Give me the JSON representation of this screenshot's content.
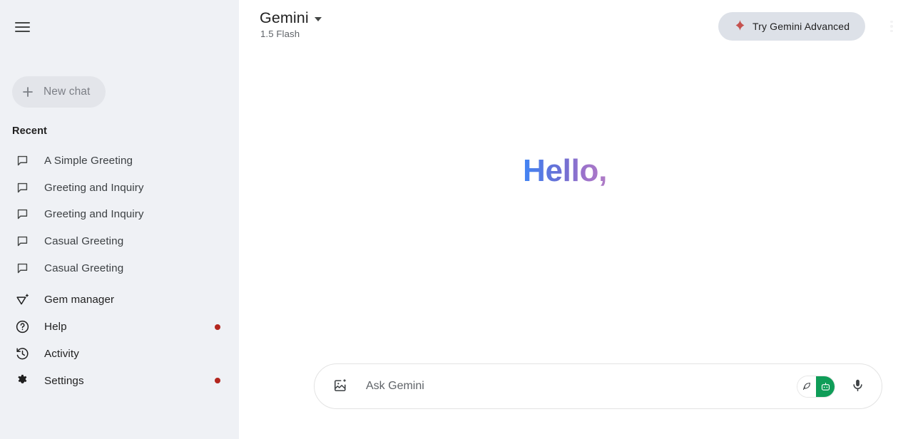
{
  "sidebar": {
    "menu_icon": "hamburger-menu-icon",
    "new_chat": {
      "label": "New chat",
      "icon": "plus-icon"
    },
    "recent_label": "Recent",
    "recent_chats": [
      {
        "label": "A Simple Greeting",
        "icon": "chat-bubble-icon"
      },
      {
        "label": "Greeting and Inquiry",
        "icon": "chat-bubble-icon"
      },
      {
        "label": "Greeting and Inquiry",
        "icon": "chat-bubble-icon"
      },
      {
        "label": "Casual Greeting",
        "icon": "chat-bubble-icon"
      },
      {
        "label": "Casual Greeting",
        "icon": "chat-bubble-icon"
      }
    ],
    "bottom_items": [
      {
        "label": "Gem manager",
        "icon": "gem-icon",
        "badge": false
      },
      {
        "label": "Help",
        "icon": "help-circle-icon",
        "badge": true
      },
      {
        "label": "Activity",
        "icon": "history-icon",
        "badge": false
      },
      {
        "label": "Settings",
        "icon": "gear-icon",
        "badge": true
      }
    ]
  },
  "header": {
    "model_name": "Gemini",
    "model_version": "1.5 Flash",
    "caret_icon": "chevron-down-icon",
    "advanced_button": {
      "label": "Try Gemini Advanced",
      "icon": "sparkle-icon"
    },
    "more_menu_icon": "more-vertical-icon"
  },
  "main": {
    "greeting": "Hello,"
  },
  "composer": {
    "add_image_icon": "add-image-icon",
    "input_value": "",
    "placeholder": "Ask Gemini",
    "mode_toggle": {
      "left_icon": "feather-pen-icon",
      "right_icon": "robot-face-icon"
    },
    "mic_icon": "microphone-icon"
  },
  "colors": {
    "sidebar_bg": "#eff1f5",
    "main_bg": "#ffffff",
    "badge_red": "#b3261e",
    "sparkle_red": "#c5524f",
    "toggle_green": "#0f9d58",
    "greeting_gradient_start": "#4285f4",
    "greeting_gradient_end": "#b07cc6",
    "new_chat_bg": "#e3e5ea",
    "advanced_btn_bg": "#dde1e8"
  }
}
